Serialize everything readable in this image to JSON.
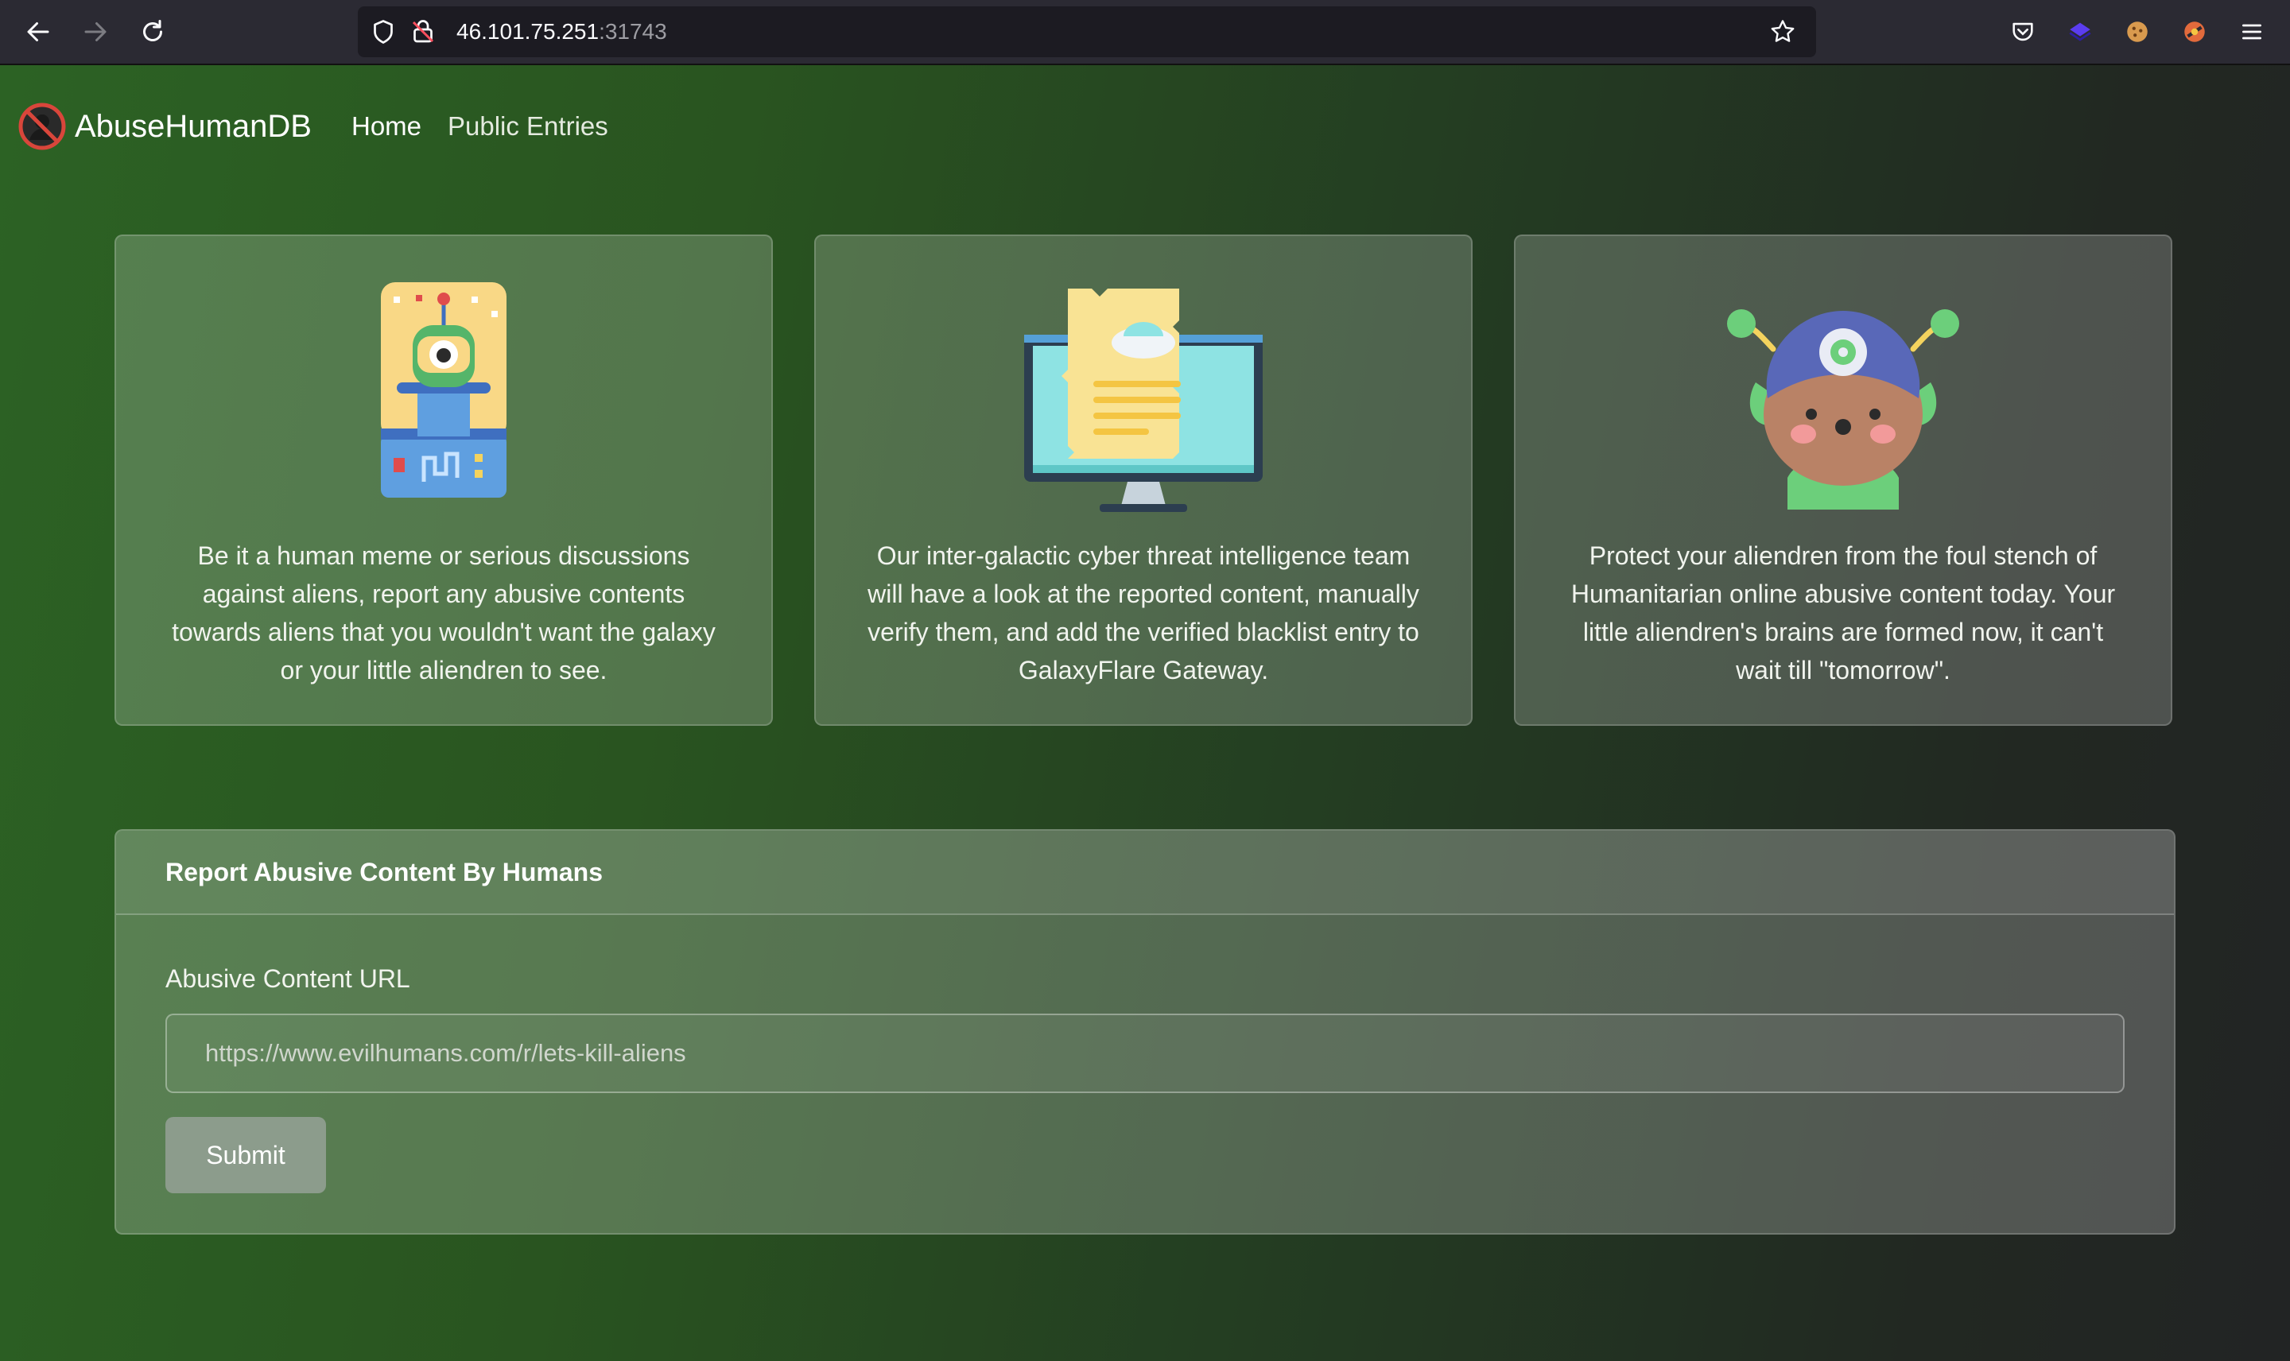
{
  "browser": {
    "url_host": "46.101.75.251",
    "url_port": ":31743",
    "icons": [
      "back-icon",
      "forward-icon",
      "reload-icon",
      "shield-icon",
      "lock-icon",
      "star-icon",
      "pocket-icon",
      "extension-icon",
      "cookie-icon",
      "extension-2-icon",
      "menu-icon"
    ]
  },
  "navbar": {
    "brand": "AbuseHumanDB",
    "links": [
      {
        "label": "Home"
      },
      {
        "label": "Public Entries"
      }
    ]
  },
  "cards": [
    {
      "text": "Be it a human meme or serious discussions against aliens, report any abusive contents towards aliens that you wouldn't want the galaxy or your little aliendren to see.",
      "icon": "alien-robot-icon"
    },
    {
      "text": "Our inter-galactic cyber threat intelligence team will have a look at the reported content, manually verify them, and add the verified blacklist entry to GalaxyFlare Gateway.",
      "icon": "monitor-document-icon"
    },
    {
      "text": "Protect your aliendren from the foul stench of Humanitarian online abusive content today. Your little aliendren's brains are formed now, it can't wait till \"tomorrow\".",
      "icon": "alien-child-icon"
    }
  ],
  "report": {
    "title": "Report Abusive Content By Humans",
    "field_label": "Abusive Content URL",
    "placeholder": "https://www.evilhumans.com/r/lets-kill-aliens",
    "submit_label": "Submit"
  },
  "colors": {
    "page_gradient_start": "#2c6224",
    "page_gradient_end": "#222424",
    "submit_button": "#8c9c8c"
  }
}
